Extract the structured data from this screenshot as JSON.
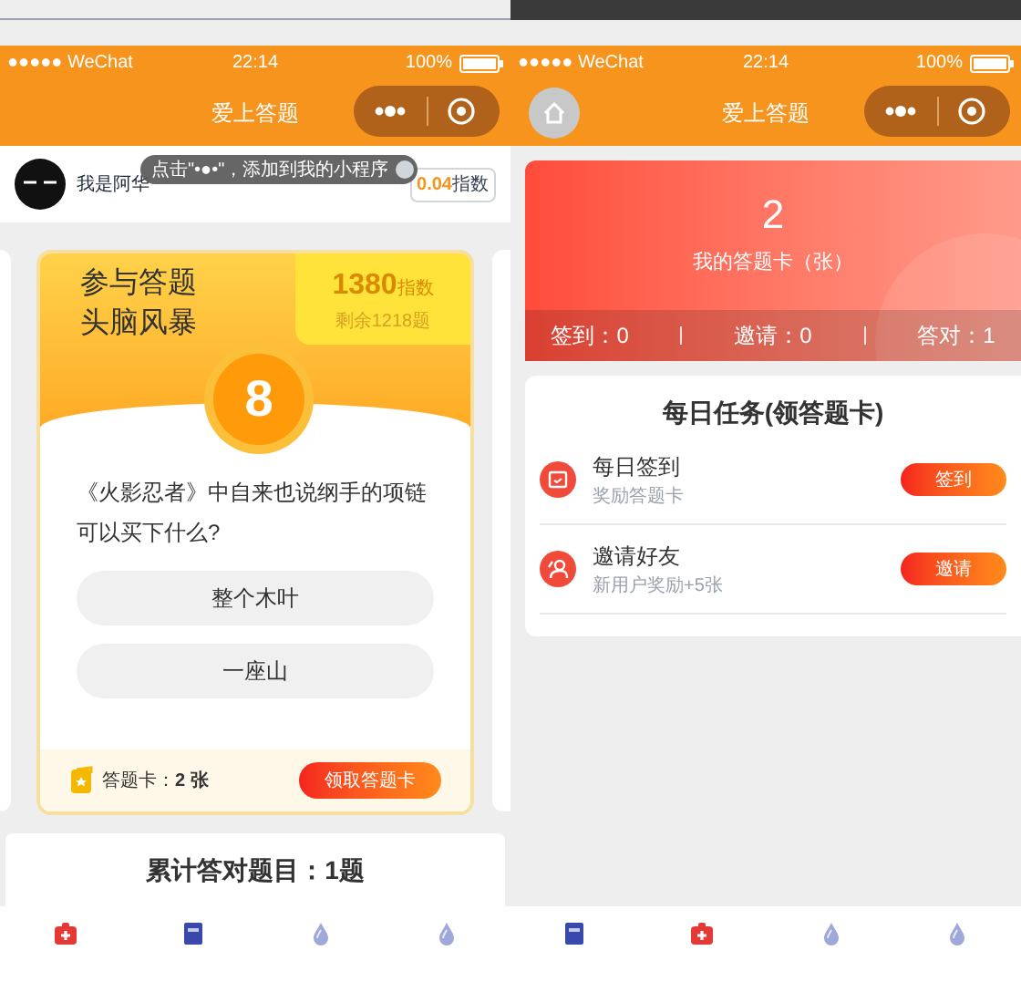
{
  "left_phone": {
    "status_bar": {
      "carrier": "●●●●● WeChat",
      "time": "22:14",
      "battery": "100%"
    },
    "nav": {
      "title": "爱上答题"
    },
    "user": {
      "name": "我是阿华",
      "score": "0.04",
      "score_unit": "指数"
    },
    "tooltip": "点击\"•●•\"，添加到我的小程序",
    "quiz_card": {
      "title_line_1": "参与答题",
      "title_line_2": "头脑风暴",
      "points": "1380",
      "points_unit": "指数",
      "remaining": "剩余1218题",
      "countdown": "8",
      "question": "《火影忍者》中自来也说纲手的项链可以买下什么?",
      "options": [
        "整个木叶",
        "一座山"
      ],
      "cards_label": "答题卡：",
      "cards_count": "2 张",
      "claim_button": "领取答题卡"
    },
    "total": {
      "label": "累计答对题目：1题"
    },
    "tab_bar": [
      {
        "kind": "medkit"
      },
      {
        "kind": "book"
      },
      {
        "kind": "drop"
      },
      {
        "kind": "drop"
      }
    ]
  },
  "right_phone": {
    "status_bar": {
      "carrier": "●●●●● WeChat",
      "time": "22:14",
      "battery": "100%"
    },
    "nav": {
      "title": "爱上答题",
      "home_button": true
    },
    "card_summary": {
      "count": "2",
      "label": "我的答题卡（张）",
      "stats": [
        "签到：0",
        "邀请：0",
        "答对：1"
      ]
    },
    "tasks": {
      "title": "每日任务(领答题卡)",
      "items": [
        {
          "kind": "calendar",
          "name": "每日签到",
          "description": "奖励答题卡",
          "button": "签到"
        },
        {
          "kind": "people",
          "name": "邀请好友",
          "description": "新用户奖励+5张",
          "button": "邀请"
        }
      ]
    },
    "tab_bar": [
      {
        "kind": "book"
      },
      {
        "kind": "medkit"
      },
      {
        "kind": "drop"
      },
      {
        "kind": "drop"
      }
    ]
  }
}
